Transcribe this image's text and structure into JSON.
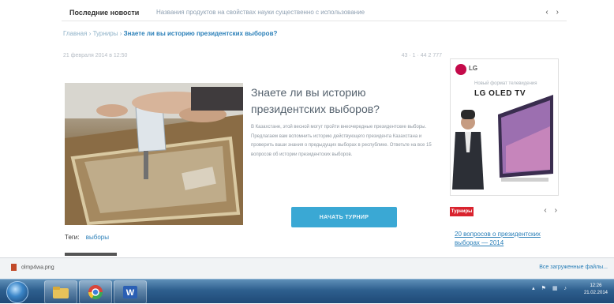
{
  "news": {
    "label": "Последние новости",
    "text": "Названия продуктов на свойствах науки существенно с использование"
  },
  "breadcrumb": {
    "home": "Главная",
    "section": "Турниры",
    "current": "Знаете ли вы историю президентских выборов?"
  },
  "meta": {
    "date": "21 февраля 2014 в 12:50",
    "stats": "43   ·   1   ·   44   2 777"
  },
  "article": {
    "title": "Знаете ли вы историю президентских выборов?",
    "body": "В Казахстане, этой весной могут пройти внеочередные президентские выборы. Предлагаем вам вспомнить историю действующего президента Казахстана и проверить ваши знания о предыдущих выборах в республике. Ответьте на все 15 вопросов об истории президентских выборов.",
    "button": "НАЧАТЬ ТУРНИР"
  },
  "tags": {
    "label": "Теги:",
    "value": "выборы"
  },
  "ad": {
    "logo": "LG",
    "tagline": "Новый формат телевидения",
    "brand": "LG OLED TV"
  },
  "sidebar": {
    "badge": "Турниры",
    "link": "20 вопросов о президентских выборах — 2014"
  },
  "download": {
    "file": "olmp4wa.png",
    "show_all": "Все загруженные файлы..."
  },
  "taskbar": {
    "time": "12:26",
    "date": "21.02.2014"
  },
  "colors": {
    "accent": "#3aa8d4",
    "link": "#2a7fb8",
    "badge": "#d9232e",
    "lg_brand": "#c40a4a"
  }
}
